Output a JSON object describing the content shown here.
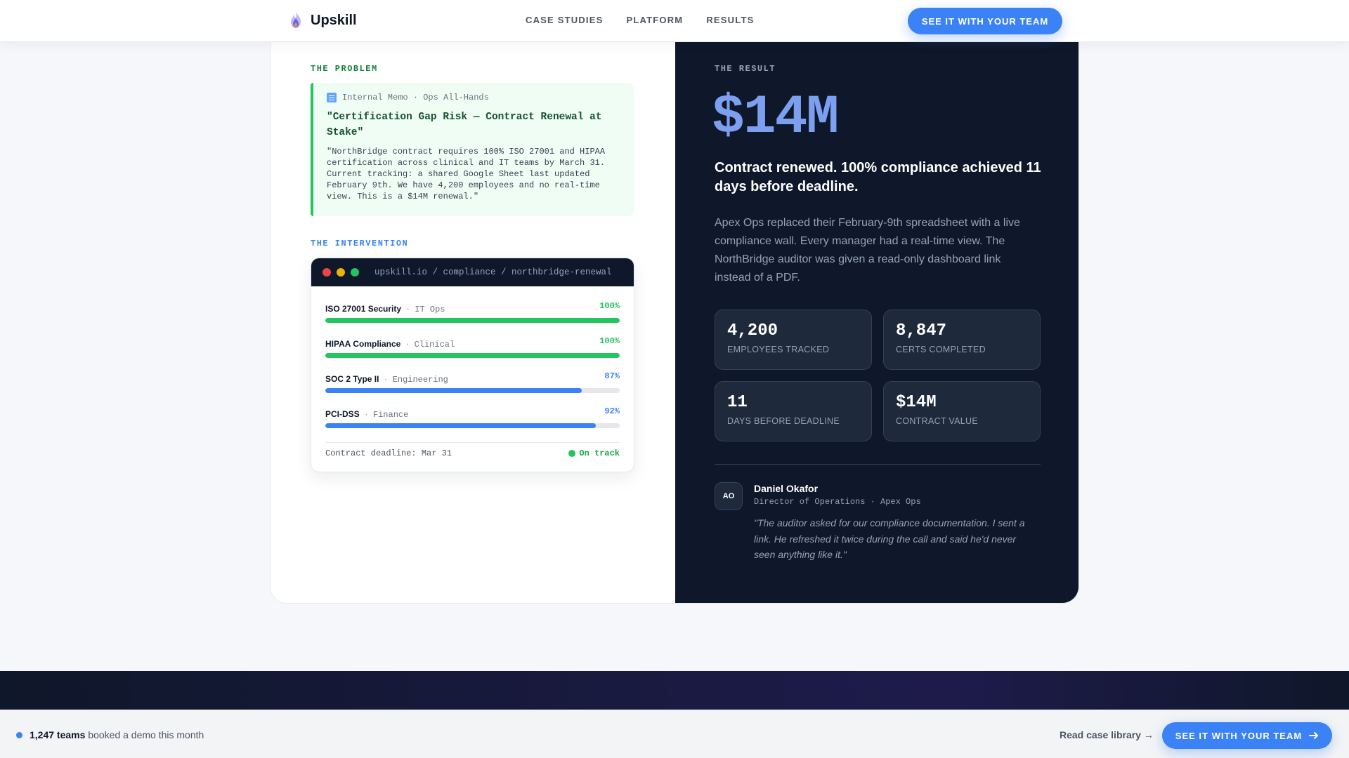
{
  "header": {
    "brand": "Upskill",
    "nav": [
      "CASE STUDIES",
      "PLATFORM",
      "RESULTS"
    ],
    "cta": "SEE IT WITH YOUR TEAM"
  },
  "problem": {
    "label": "THE PROBLEM",
    "memo_source": "Internal Memo · Ops All-Hands",
    "memo_title": "\"Certification Gap Risk — Contract Renewal at Stake\"",
    "memo_body": "\"NorthBridge contract requires 100% ISO 27001 and HIPAA certification across clinical and IT teams by March 31. Current tracking: a shared Google Sheet last updated February 9th. We have 4,200 employees and no real-time view. This is a $14M renewal.\""
  },
  "intervention": {
    "label": "THE INTERVENTION",
    "url": "upskill.io / compliance / northbridge-renewal",
    "rows": [
      {
        "name": "ISO 27001 Security",
        "team": "IT Ops",
        "pct": "100%",
        "value": 100,
        "color": "#22c55e"
      },
      {
        "name": "HIPAA Compliance",
        "team": "Clinical",
        "pct": "100%",
        "value": 100,
        "color": "#22c55e"
      },
      {
        "name": "SOC 2 Type II",
        "team": "Engineering",
        "pct": "87%",
        "value": 87,
        "color": "#3b82f6"
      },
      {
        "name": "PCI-DSS",
        "team": "Finance",
        "pct": "92%",
        "value": 92,
        "color": "#3b82f6"
      }
    ],
    "deadline": "Contract deadline: Mar 31",
    "status": "On track"
  },
  "result": {
    "label": "THE RESULT",
    "amount": "$14M",
    "headline": "Contract renewed. 100% compliance achieved 11 days before deadline.",
    "description": "Apex Ops replaced their February-9th spreadsheet with a live compliance wall. Every manager had a real-time view. The NorthBridge auditor was given a read-only dashboard link instead of a PDF.",
    "stats": [
      {
        "value": "4,200",
        "label": "EMPLOYEES TRACKED"
      },
      {
        "value": "8,847",
        "label": "CERTS COMPLETED"
      },
      {
        "value": "11",
        "label": "DAYS BEFORE DEADLINE"
      },
      {
        "value": "$14M",
        "label": "CONTRACT VALUE"
      }
    ],
    "testimonial": {
      "initials": "AO",
      "name": "Daniel Okafor",
      "role": "Director of Operations · Apex Ops",
      "quote": "\"The auditor asked for our compliance documentation. I sent a link. He refreshed it twice during the call and said he'd never seen anything like it.\""
    }
  },
  "sticky": {
    "count": "1,247 teams",
    "text": "booked a demo this month",
    "link": "Read case library →",
    "cta": "SEE IT WITH YOUR TEAM"
  },
  "colors": {
    "accent": "#3b82f6",
    "success": "#22c55e",
    "dark": "#0f172a"
  }
}
